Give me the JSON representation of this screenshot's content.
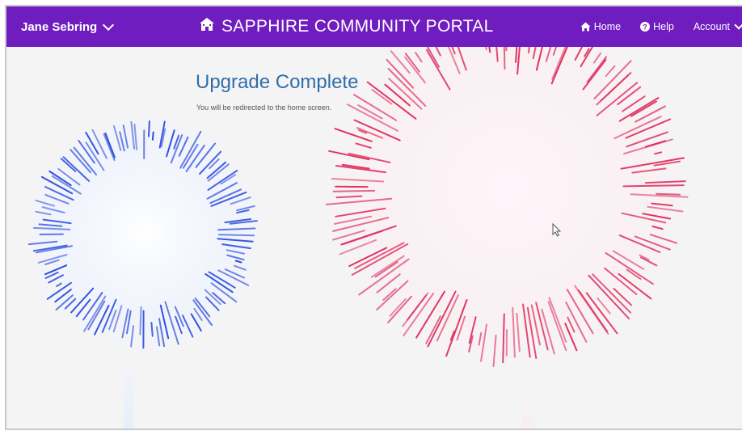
{
  "user": {
    "name": "Jane Sebring",
    "dropdown_icon": "chevron-down-icon"
  },
  "brand": {
    "icon": "house-icon",
    "title": "SAPPHIRE COMMUNITY PORTAL"
  },
  "nav": {
    "home": {
      "icon": "home-icon",
      "label": "Home"
    },
    "help": {
      "icon": "question-circle-icon",
      "label": "Help"
    },
    "account": {
      "label": "Account",
      "dropdown_icon": "chevron-down-icon"
    }
  },
  "main": {
    "title": "Upgrade Complete",
    "message": "You will be redirected to the home screen."
  },
  "colors": {
    "brand": "#6f1dbf",
    "heading": "#2f6ea8",
    "firework_blue": "#2e4fe0",
    "firework_red": "#e0305f"
  }
}
